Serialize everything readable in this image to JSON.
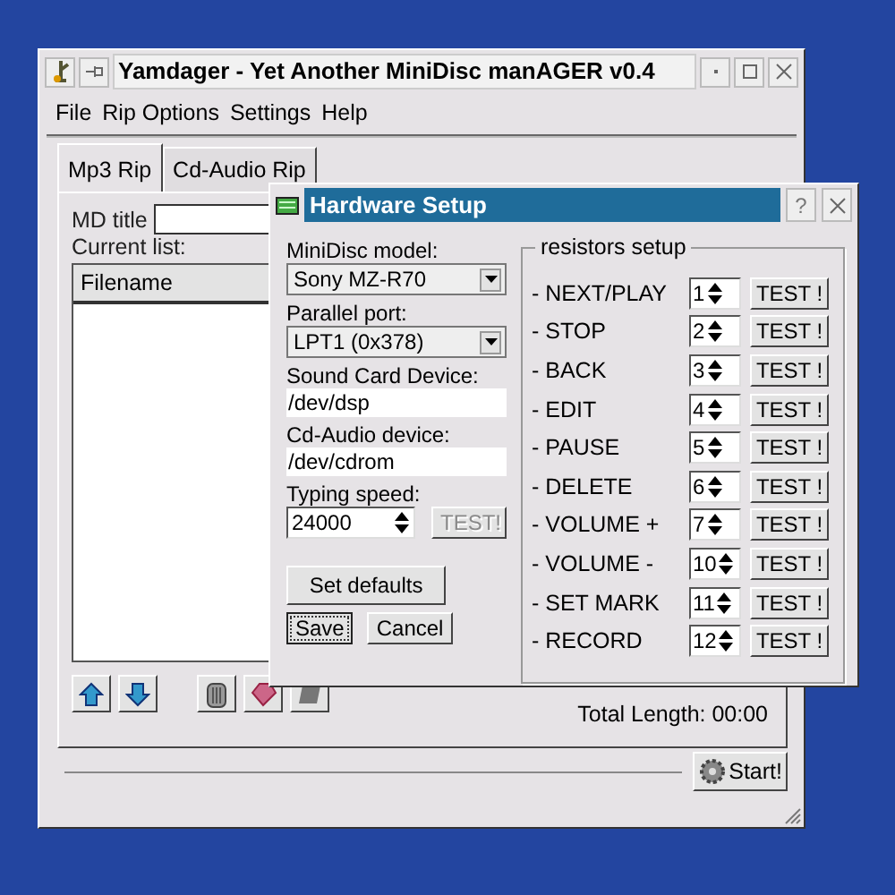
{
  "main_window": {
    "title": "Yamdager - Yet Another MiniDisc manAGER v0.4",
    "menu": [
      "File",
      "Rip Options",
      "Settings",
      "Help"
    ],
    "tabs": [
      {
        "label": "Mp3 Rip",
        "selected": true
      },
      {
        "label": "Cd-Audio Rip",
        "selected": false
      }
    ],
    "md_title": {
      "label": "MD title"
    },
    "current_list": {
      "label": "Current list:",
      "columns": [
        "Filename"
      ]
    },
    "total_length": "Total Length: 00:00",
    "start_button": "Start!"
  },
  "dialog": {
    "title": "Hardware Setup",
    "help_button": "?",
    "minidisc_model": {
      "label": "MiniDisc model:",
      "value": "Sony MZ-R70"
    },
    "parallel_port": {
      "label": "Parallel port:",
      "value": "LPT1 (0x378)"
    },
    "sound_card": {
      "label": "Sound Card Device:",
      "value": "/dev/dsp"
    },
    "cdaudio": {
      "label": "Cd-Audio device:",
      "value": "/dev/cdrom"
    },
    "typing_speed": {
      "label": "Typing speed:",
      "value": "24000",
      "test": "TEST!",
      "test_disabled": true
    },
    "set_defaults": "Set defaults",
    "save": "Save",
    "cancel": "Cancel",
    "resistors": {
      "title": "resistors setup",
      "rows": [
        {
          "label": "- NEXT/PLAY",
          "value": "1",
          "test": "TEST !"
        },
        {
          "label": "- STOP",
          "value": "2",
          "test": "TEST !"
        },
        {
          "label": "- BACK",
          "value": "3",
          "test": "TEST !"
        },
        {
          "label": "- EDIT",
          "value": "4",
          "test": "TEST !"
        },
        {
          "label": "- PAUSE",
          "value": "5",
          "test": "TEST !"
        },
        {
          "label": "- DELETE",
          "value": "6",
          "test": "TEST !"
        },
        {
          "label": "- VOLUME +",
          "value": "7",
          "test": "TEST !"
        },
        {
          "label": "- VOLUME -",
          "value": "10",
          "test": "TEST !"
        },
        {
          "label": "- SET MARK",
          "value": "11",
          "test": "TEST !"
        },
        {
          "label": "- RECORD",
          "value": "12",
          "test": "TEST !"
        }
      ]
    }
  }
}
